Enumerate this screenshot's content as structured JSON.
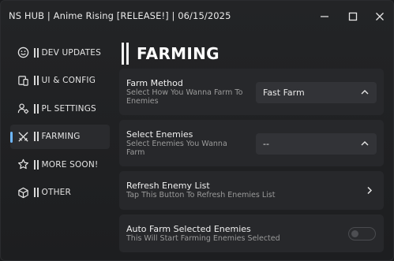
{
  "window": {
    "title": "NS HUB  |  Anime Rising [RELEASE!]  |  06/15/2025"
  },
  "sidebar": {
    "items": [
      {
        "label": "DEV UPDATES",
        "icon": "smiley-icon",
        "active": false
      },
      {
        "label": "UI & CONFIG",
        "icon": "devices-icon",
        "active": false
      },
      {
        "label": "PL SETTINGS",
        "icon": "user-settings-icon",
        "active": false
      },
      {
        "label": "FARMING",
        "icon": "crossed-swords-icon",
        "active": true
      },
      {
        "label": "MORE SOON!",
        "icon": "star-icon",
        "active": false
      },
      {
        "label": "OTHER",
        "icon": "cube-icon",
        "active": false
      }
    ]
  },
  "section": {
    "title": "FARMING"
  },
  "cards": {
    "farm_method": {
      "title": "Farm Method",
      "description": "Select How You Wanna Farm To Enemies",
      "value": "Fast Farm"
    },
    "select_enemies": {
      "title": "Select Enemies",
      "description": "Select Enemies You Wanna Farm",
      "value": "--"
    },
    "refresh_enemy_list": {
      "title": "Refresh Enemy List",
      "description": "Tap This Button To Refresh Enemies List"
    },
    "auto_farm": {
      "title": "Auto Farm Selected Enemies",
      "description": "This Will Start Farming Enemies Selected",
      "enabled": false
    }
  },
  "colors": {
    "accent": "#6eb7ff",
    "background": "#1d1e20",
    "card": "#27282b"
  }
}
